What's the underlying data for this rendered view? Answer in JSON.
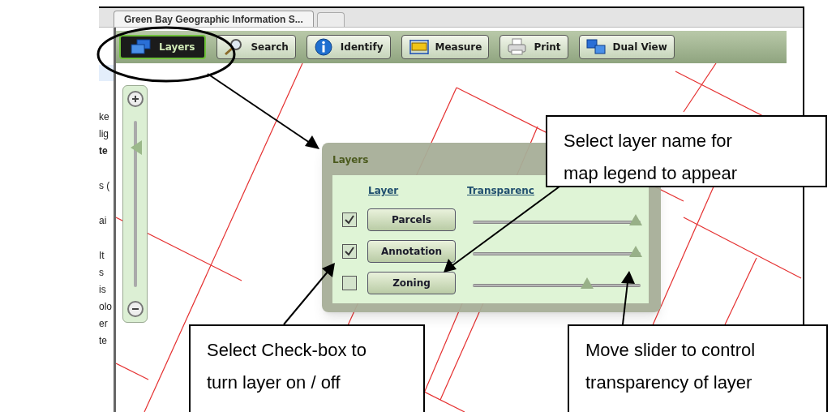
{
  "browser_tab": {
    "title": "Green Bay Geographic Information S..."
  },
  "left_panel_fragments": [
    [
      {
        "text": "ke",
        "bold": false
      },
      {
        "text": "lig",
        "bold": false
      },
      {
        "text": "te",
        "bold": true
      }
    ],
    [
      {
        "text": "s (",
        "bold": false
      }
    ],
    [
      {
        "text": "ai",
        "bold": false
      }
    ],
    [
      {
        "text": "It",
        "bold": false
      },
      {
        "text": "s",
        "bold": false
      },
      {
        "text": "is",
        "bold": false
      },
      {
        "text": "olo",
        "bold": false
      },
      {
        "text": "er",
        "bold": false
      },
      {
        "text": "te",
        "bold": false
      }
    ]
  ],
  "toolbar": {
    "buttons": [
      {
        "label": "Layers",
        "selected": true
      },
      {
        "label": "Search",
        "selected": false
      },
      {
        "label": "Identify",
        "selected": false
      },
      {
        "label": "Measure",
        "selected": false
      },
      {
        "label": "Print",
        "selected": false
      },
      {
        "label": "Dual View",
        "selected": false
      }
    ]
  },
  "zoom_slider": {
    "level": 0.84
  },
  "layers_panel": {
    "title": "Layers",
    "columns": [
      "Layer",
      "Transparenc"
    ],
    "rows": [
      {
        "name": "Parcels",
        "checked": true,
        "level": 0.97
      },
      {
        "name": "Annotation",
        "checked": true,
        "level": 0.97
      },
      {
        "name": "Zoning",
        "checked": false,
        "level": 0.68
      }
    ]
  },
  "callouts": [
    {
      "text": "Select layer name for map legend to appear"
    },
    {
      "text": "Select Check-box to turn layer on / off"
    },
    {
      "text": "Move slider to control transparency of layer"
    }
  ]
}
